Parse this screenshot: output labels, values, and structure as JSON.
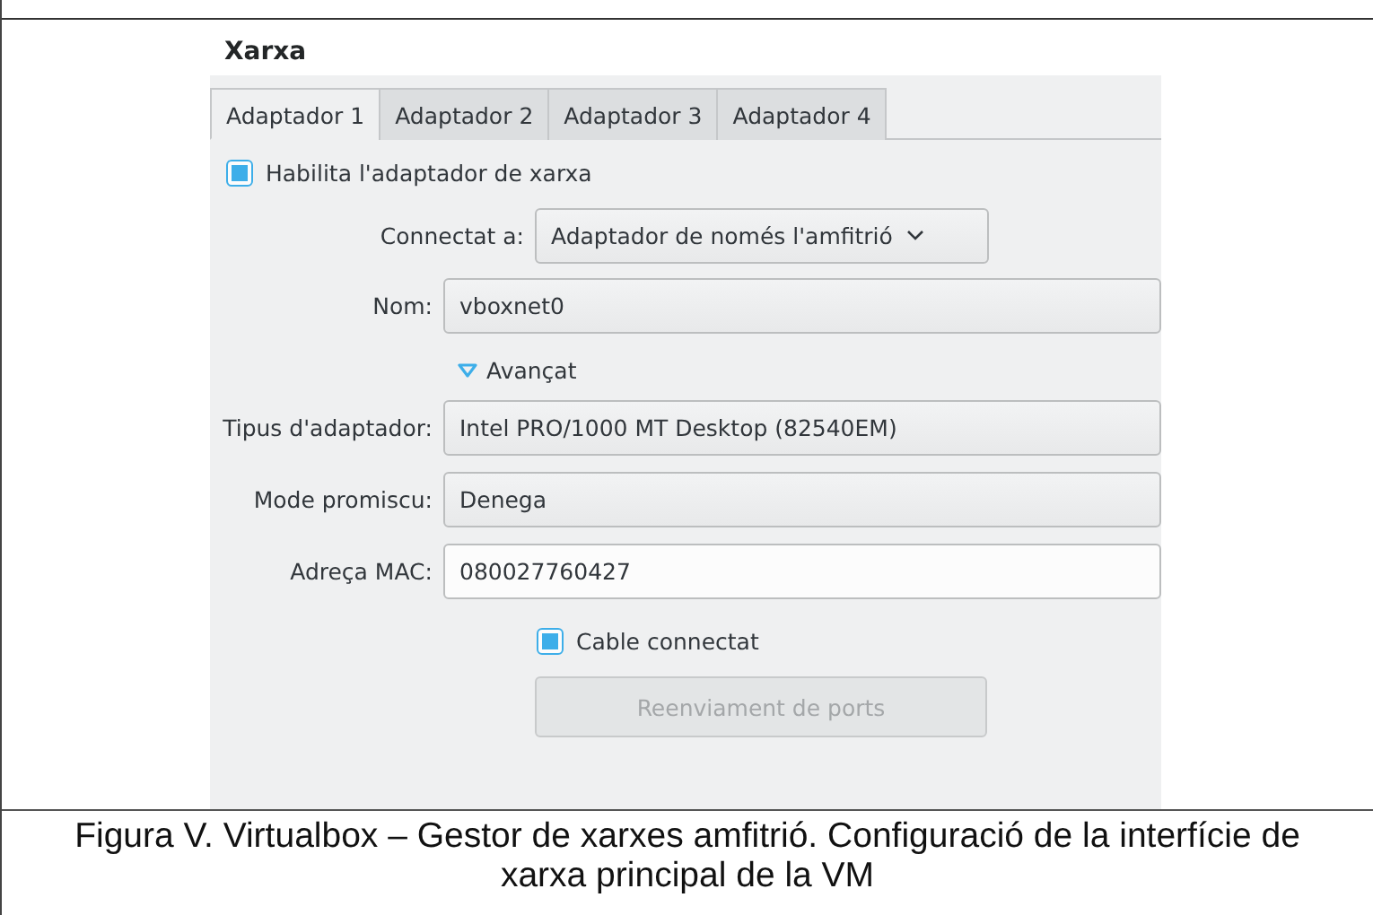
{
  "section_title": "Xarxa",
  "tabs": [
    {
      "label": "Adaptador 1",
      "selected": true
    },
    {
      "label": "Adaptador 2",
      "selected": false
    },
    {
      "label": "Adaptador 3",
      "selected": false
    },
    {
      "label": "Adaptador 4",
      "selected": false
    }
  ],
  "enable_adapter": {
    "label": "Habilita l'adaptador de xarxa",
    "checked": true
  },
  "fields": [
    {
      "kind": "dropdown",
      "label": "Connectat a:",
      "value": "Adaptador de només l'amfitrió"
    },
    {
      "kind": "combo",
      "label": "Nom:",
      "value": "vboxnet0"
    }
  ],
  "advanced": {
    "label": "Avançat",
    "expanded": true
  },
  "advanced_fields": [
    {
      "kind": "combo",
      "label": "Tipus d'adaptador:",
      "value": "Intel PRO/1000 MT Desktop (82540EM)"
    },
    {
      "kind": "combo",
      "label": "Mode promiscu:",
      "value": "Denega"
    },
    {
      "kind": "input",
      "label": "Adreça MAC:",
      "value": "080027760427"
    }
  ],
  "cable_connected": {
    "label": "Cable connectat",
    "checked": true
  },
  "port_forwarding_button": {
    "label": "Reenviament de ports",
    "disabled": true
  },
  "caption": "Figura V. Virtualbox – Gestor de xarxes amfitrió. Configuració de la interfície de xarxa principal de la VM"
}
